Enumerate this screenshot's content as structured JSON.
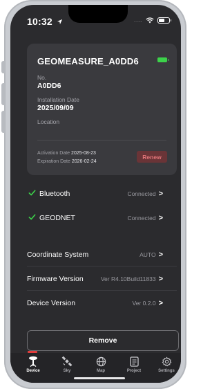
{
  "status_bar": {
    "time": "10:32",
    "signal_text": "...."
  },
  "device": {
    "name": "GEOMEASURE_A0DD6",
    "no_label": "No.",
    "no_value": "A0DD6",
    "install_label": "Installation Date",
    "install_value": "2025/09/09",
    "location_label": "Location",
    "activation_label": "Activation Date",
    "activation_value": "2025-08-23",
    "expiration_label": "Expiration Date",
    "expiration_value": "2026-02-24",
    "renew_label": "Renew",
    "battery_color": "#3cd24a"
  },
  "connections": [
    {
      "label": "Bluetooth",
      "status": "Connected"
    },
    {
      "label": "GEODNET",
      "status": "Connected"
    }
  ],
  "settings": [
    {
      "label": "Coordinate System",
      "value": "AUTO"
    },
    {
      "label": "Firmware Version",
      "value": "Ver R4.10Build11833"
    },
    {
      "label": "Device Version",
      "value": "Ver 0.2.0"
    }
  ],
  "chevron": ">",
  "remove_label": "Remove",
  "tabs": [
    {
      "label": "Device",
      "icon": "device-icon",
      "active": true
    },
    {
      "label": "Sky",
      "icon": "satellite-icon",
      "active": false
    },
    {
      "label": "Map",
      "icon": "globe-icon",
      "active": false
    },
    {
      "label": "Project",
      "icon": "project-icon",
      "active": false
    },
    {
      "label": "Settings",
      "icon": "gear-icon",
      "active": false
    }
  ],
  "colors": {
    "background": "#2b2b2e",
    "card": "#3a3a3e",
    "accent_green": "#3cd24a",
    "renew_bg": "#6a3437",
    "renew_text": "#e07478"
  }
}
